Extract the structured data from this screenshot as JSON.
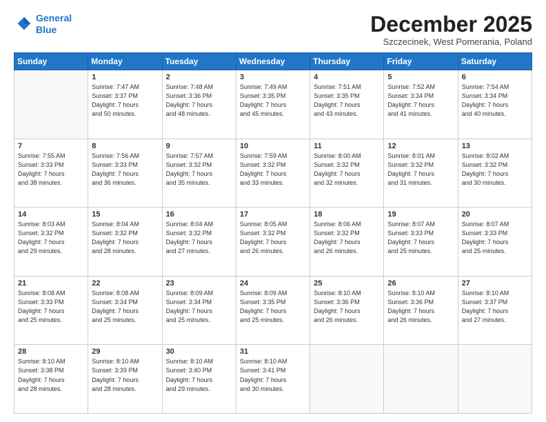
{
  "header": {
    "logo_line1": "General",
    "logo_line2": "Blue",
    "month": "December 2025",
    "location": "Szczecinek, West Pomerania, Poland"
  },
  "weekdays": [
    "Sunday",
    "Monday",
    "Tuesday",
    "Wednesday",
    "Thursday",
    "Friday",
    "Saturday"
  ],
  "weeks": [
    [
      {
        "day": "",
        "info": ""
      },
      {
        "day": "1",
        "info": "Sunrise: 7:47 AM\nSunset: 3:37 PM\nDaylight: 7 hours\nand 50 minutes."
      },
      {
        "day": "2",
        "info": "Sunrise: 7:48 AM\nSunset: 3:36 PM\nDaylight: 7 hours\nand 48 minutes."
      },
      {
        "day": "3",
        "info": "Sunrise: 7:49 AM\nSunset: 3:35 PM\nDaylight: 7 hours\nand 45 minutes."
      },
      {
        "day": "4",
        "info": "Sunrise: 7:51 AM\nSunset: 3:35 PM\nDaylight: 7 hours\nand 43 minutes."
      },
      {
        "day": "5",
        "info": "Sunrise: 7:52 AM\nSunset: 3:34 PM\nDaylight: 7 hours\nand 41 minutes."
      },
      {
        "day": "6",
        "info": "Sunrise: 7:54 AM\nSunset: 3:34 PM\nDaylight: 7 hours\nand 40 minutes."
      }
    ],
    [
      {
        "day": "7",
        "info": "Sunrise: 7:55 AM\nSunset: 3:33 PM\nDaylight: 7 hours\nand 38 minutes."
      },
      {
        "day": "8",
        "info": "Sunrise: 7:56 AM\nSunset: 3:33 PM\nDaylight: 7 hours\nand 36 minutes."
      },
      {
        "day": "9",
        "info": "Sunrise: 7:57 AM\nSunset: 3:32 PM\nDaylight: 7 hours\nand 35 minutes."
      },
      {
        "day": "10",
        "info": "Sunrise: 7:59 AM\nSunset: 3:32 PM\nDaylight: 7 hours\nand 33 minutes."
      },
      {
        "day": "11",
        "info": "Sunrise: 8:00 AM\nSunset: 3:32 PM\nDaylight: 7 hours\nand 32 minutes."
      },
      {
        "day": "12",
        "info": "Sunrise: 8:01 AM\nSunset: 3:32 PM\nDaylight: 7 hours\nand 31 minutes."
      },
      {
        "day": "13",
        "info": "Sunrise: 8:02 AM\nSunset: 3:32 PM\nDaylight: 7 hours\nand 30 minutes."
      }
    ],
    [
      {
        "day": "14",
        "info": "Sunrise: 8:03 AM\nSunset: 3:32 PM\nDaylight: 7 hours\nand 29 minutes."
      },
      {
        "day": "15",
        "info": "Sunrise: 8:04 AM\nSunset: 3:32 PM\nDaylight: 7 hours\nand 28 minutes."
      },
      {
        "day": "16",
        "info": "Sunrise: 8:04 AM\nSunset: 3:32 PM\nDaylight: 7 hours\nand 27 minutes."
      },
      {
        "day": "17",
        "info": "Sunrise: 8:05 AM\nSunset: 3:32 PM\nDaylight: 7 hours\nand 26 minutes."
      },
      {
        "day": "18",
        "info": "Sunrise: 8:06 AM\nSunset: 3:32 PM\nDaylight: 7 hours\nand 26 minutes."
      },
      {
        "day": "19",
        "info": "Sunrise: 8:07 AM\nSunset: 3:33 PM\nDaylight: 7 hours\nand 25 minutes."
      },
      {
        "day": "20",
        "info": "Sunrise: 8:07 AM\nSunset: 3:33 PM\nDaylight: 7 hours\nand 25 minutes."
      }
    ],
    [
      {
        "day": "21",
        "info": "Sunrise: 8:08 AM\nSunset: 3:33 PM\nDaylight: 7 hours\nand 25 minutes."
      },
      {
        "day": "22",
        "info": "Sunrise: 8:08 AM\nSunset: 3:34 PM\nDaylight: 7 hours\nand 25 minutes."
      },
      {
        "day": "23",
        "info": "Sunrise: 8:09 AM\nSunset: 3:34 PM\nDaylight: 7 hours\nand 25 minutes."
      },
      {
        "day": "24",
        "info": "Sunrise: 8:09 AM\nSunset: 3:35 PM\nDaylight: 7 hours\nand 25 minutes."
      },
      {
        "day": "25",
        "info": "Sunrise: 8:10 AM\nSunset: 3:36 PM\nDaylight: 7 hours\nand 26 minutes."
      },
      {
        "day": "26",
        "info": "Sunrise: 8:10 AM\nSunset: 3:36 PM\nDaylight: 7 hours\nand 26 minutes."
      },
      {
        "day": "27",
        "info": "Sunrise: 8:10 AM\nSunset: 3:37 PM\nDaylight: 7 hours\nand 27 minutes."
      }
    ],
    [
      {
        "day": "28",
        "info": "Sunrise: 8:10 AM\nSunset: 3:38 PM\nDaylight: 7 hours\nand 28 minutes."
      },
      {
        "day": "29",
        "info": "Sunrise: 8:10 AM\nSunset: 3:39 PM\nDaylight: 7 hours\nand 28 minutes."
      },
      {
        "day": "30",
        "info": "Sunrise: 8:10 AM\nSunset: 3:40 PM\nDaylight: 7 hours\nand 29 minutes."
      },
      {
        "day": "31",
        "info": "Sunrise: 8:10 AM\nSunset: 3:41 PM\nDaylight: 7 hours\nand 30 minutes."
      },
      {
        "day": "",
        "info": ""
      },
      {
        "day": "",
        "info": ""
      },
      {
        "day": "",
        "info": ""
      }
    ]
  ]
}
